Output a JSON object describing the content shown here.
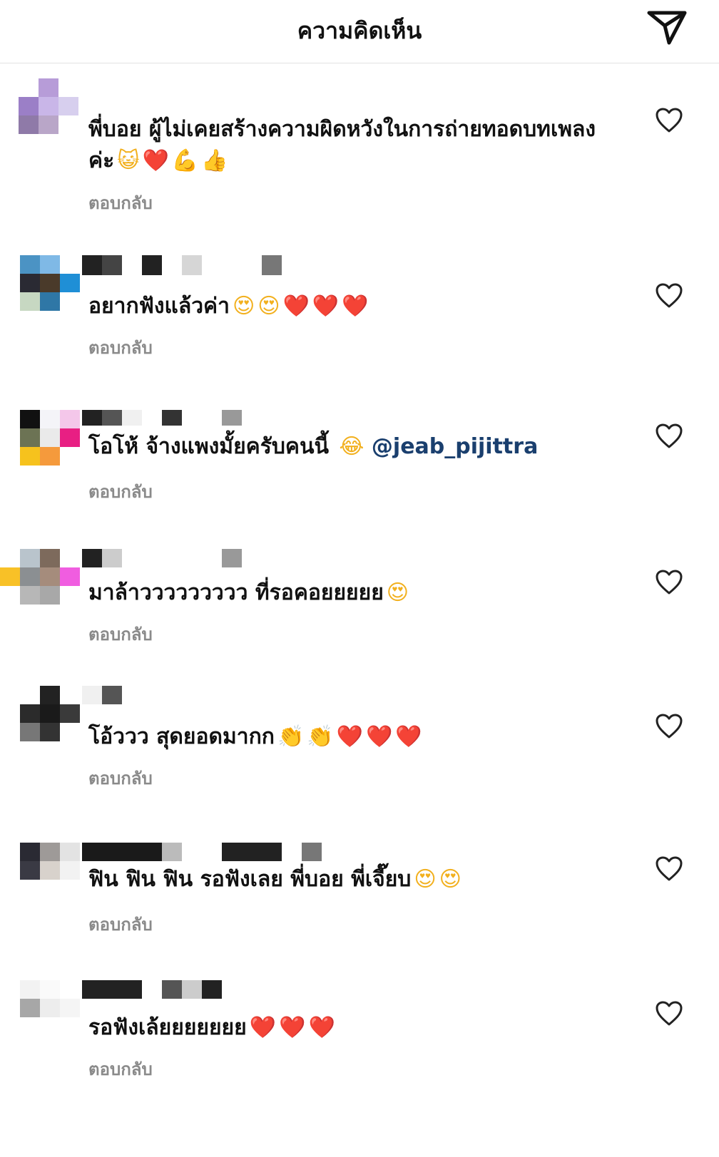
{
  "header": {
    "title": "ความคิดเห็น",
    "send_icon": "send-icon"
  },
  "comments": [
    {
      "text": "พี่บอย ผู้ไม่เคยสร้างความผิดหวังในการถ่ายทอดบทเพลงค่ะ",
      "mention": "",
      "emojis": [
        "😺",
        "❤️",
        "💪",
        "👍"
      ],
      "reply": "ตอบกลับ",
      "like_icon": "heart-outline-icon"
    },
    {
      "text": "อยากฟังแล้วค่า",
      "mention": "",
      "emojis": [
        "😍",
        "😍",
        "❤️",
        "❤️",
        "❤️"
      ],
      "reply": "ตอบกลับ",
      "like_icon": "heart-outline-icon"
    },
    {
      "text": "โอโห้ จ้างแพงมั้ยครับคนนี้",
      "mention": "@jeab_pijittra",
      "emojis": [
        "😂"
      ],
      "reply": "ตอบกลับ",
      "like_icon": "heart-outline-icon"
    },
    {
      "text": "มาล้าววววววววว ที่รอคอยยยยย",
      "mention": "",
      "emojis": [
        "😍"
      ],
      "reply": "ตอบกลับ",
      "like_icon": "heart-outline-icon"
    },
    {
      "text": "โอ้ววว สุดยอดมากก",
      "mention": "",
      "emojis": [
        "👏",
        "👏",
        "❤️",
        "❤️",
        "❤️"
      ],
      "reply": "ตอบกลับ",
      "like_icon": "heart-outline-icon"
    },
    {
      "text": "ฟิน ฟิน ฟิน รอฟังเลย พี่บอย พี่เจี๊ยบ",
      "mention": "",
      "emojis": [
        "😍",
        "😍"
      ],
      "reply": "ตอบกลับ",
      "like_icon": "heart-outline-icon"
    },
    {
      "text": "รอฟังเล้ยยยยยยย",
      "mention": "",
      "emojis": [
        "❤️",
        "❤️",
        "❤️"
      ],
      "reply": "ตอบกลับ",
      "like_icon": "heart-outline-icon"
    }
  ]
}
